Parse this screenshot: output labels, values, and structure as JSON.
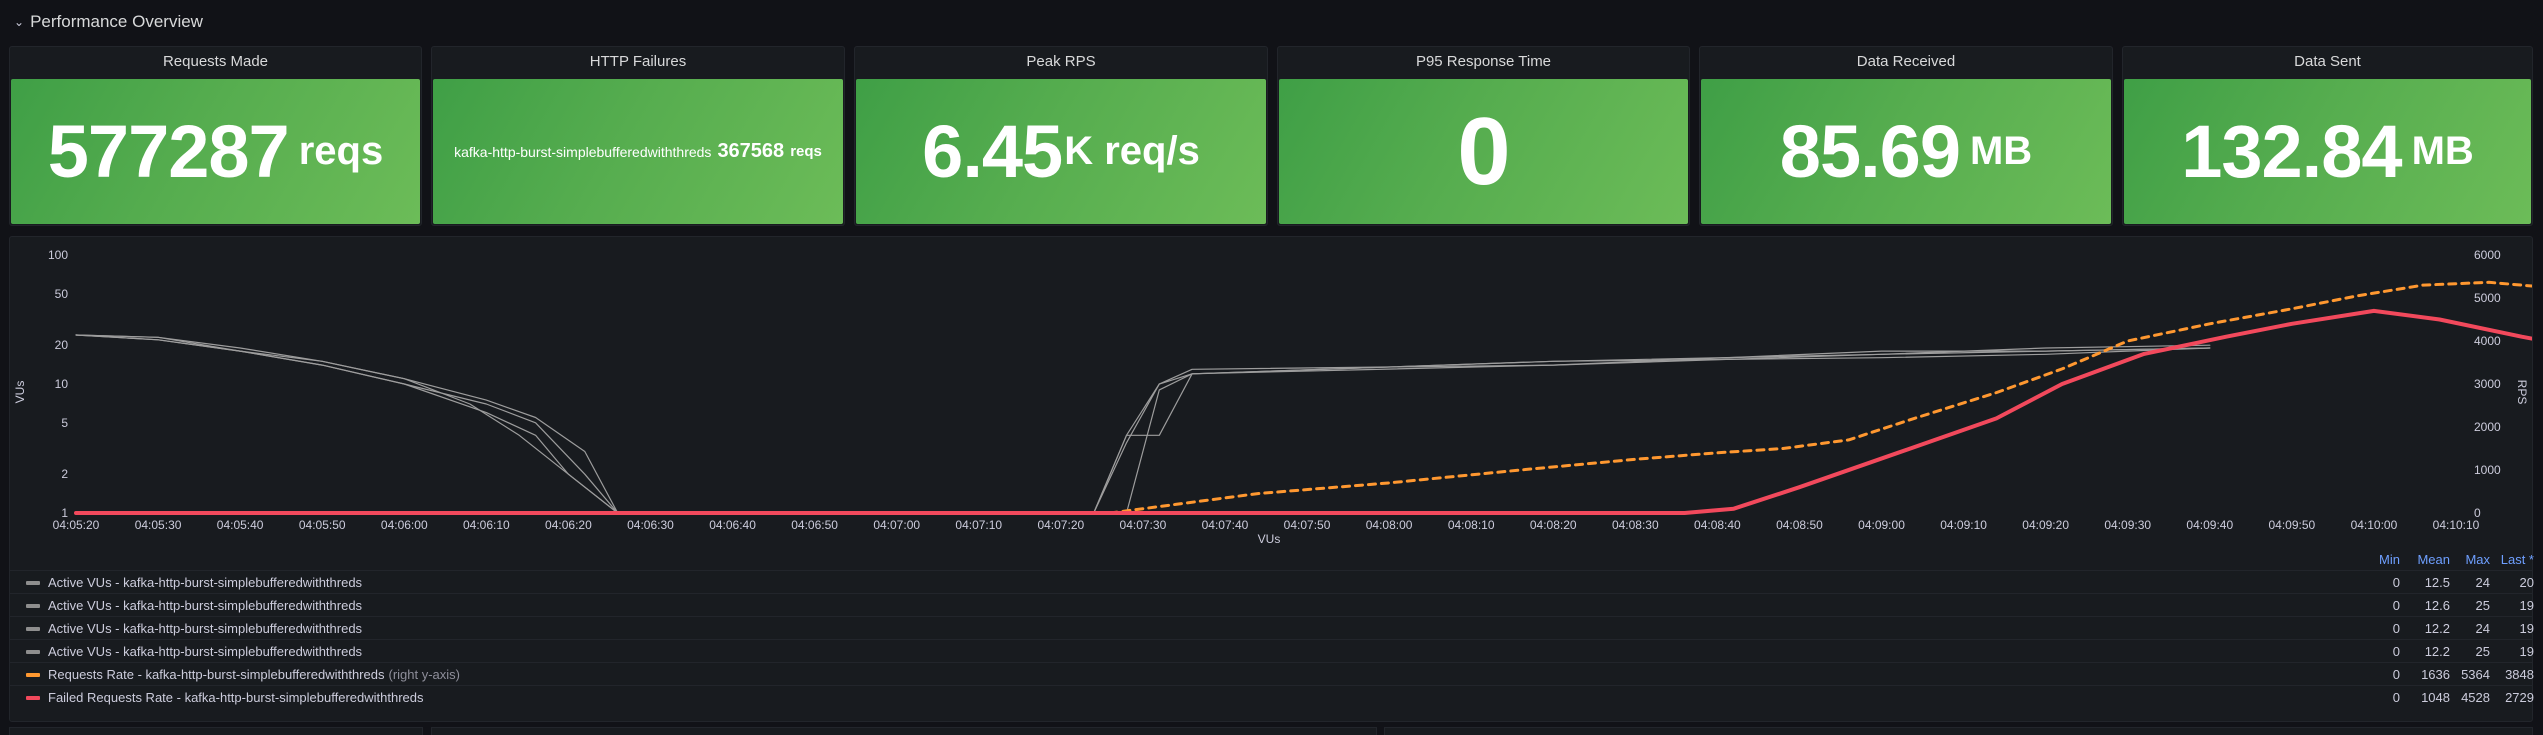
{
  "row": {
    "title": "Performance Overview"
  },
  "stats": [
    {
      "title": "Requests Made",
      "value": "577287",
      "unit": "reqs"
    },
    {
      "title": "HTTP Failures",
      "label": "kafka-http-burst-simplebufferedwiththreds",
      "value": "367568",
      "unit": "reqs"
    },
    {
      "title": "Peak RPS",
      "value": "6.45",
      "unit": "K req/s"
    },
    {
      "title": "P95 Response Time",
      "value": "0"
    },
    {
      "title": "Data Received",
      "value": "85.69",
      "unit": "MB"
    },
    {
      "title": "Data Sent",
      "value": "132.84",
      "unit": "MB"
    }
  ],
  "colors": {
    "stat_green": "#56ad4f",
    "vus": "#9d9d9d",
    "requests": "#ff9830",
    "failed": "#f2495c",
    "legend_header": "#6e9fff"
  },
  "graph": {
    "left_axis_label": "VUs",
    "right_axis_label": "RPS",
    "x_axis_label": "VUs",
    "legend_headers": {
      "min": "Min",
      "mean": "Mean",
      "max": "Max",
      "last": "Last *"
    },
    "legend": [
      {
        "name": "Active VUs - kafka-http-burst-simplebufferedwiththreds",
        "note": "",
        "color": "#8e8e8e",
        "min": "0",
        "mean": "12.5",
        "max": "24",
        "last": "20"
      },
      {
        "name": "Active VUs - kafka-http-burst-simplebufferedwiththreds",
        "note": "",
        "color": "#8e8e8e",
        "min": "0",
        "mean": "12.6",
        "max": "25",
        "last": "19"
      },
      {
        "name": "Active VUs - kafka-http-burst-simplebufferedwiththreds",
        "note": "",
        "color": "#8e8e8e",
        "min": "0",
        "mean": "12.2",
        "max": "24",
        "last": "19"
      },
      {
        "name": "Active VUs - kafka-http-burst-simplebufferedwiththreds",
        "note": "",
        "color": "#8e8e8e",
        "min": "0",
        "mean": "12.2",
        "max": "25",
        "last": "19"
      },
      {
        "name": "Requests Rate - kafka-http-burst-simplebufferedwiththreds",
        "note": "(right y-axis)",
        "color": "#ff9830",
        "min": "0",
        "mean": "1636",
        "max": "5364",
        "last": "3848"
      },
      {
        "name": "Failed Requests Rate - kafka-http-burst-simplebufferedwiththreds",
        "note": "",
        "color": "#f2495c",
        "min": "0",
        "mean": "1048",
        "max": "4528",
        "last": "2729"
      }
    ]
  },
  "chart_data": {
    "type": "line",
    "xlabel": "VUs",
    "ylabel": "VUs",
    "y2label": "RPS",
    "yscale": "log",
    "ylim": [
      1,
      100
    ],
    "y2lim": [
      0,
      6000
    ],
    "yticks": [
      "1",
      "2",
      "5",
      "10",
      "20",
      "50",
      "100"
    ],
    "y2ticks": [
      "0",
      "1000",
      "2000",
      "3000",
      "4000",
      "5000",
      "6000"
    ],
    "xticks": [
      "04:05:20",
      "04:05:30",
      "04:05:40",
      "04:05:50",
      "04:06:00",
      "04:06:10",
      "04:06:20",
      "04:06:30",
      "04:06:40",
      "04:06:50",
      "04:07:00",
      "04:07:10",
      "04:07:20",
      "04:07:30",
      "04:07:40",
      "04:07:50",
      "04:08:00",
      "04:08:10",
      "04:08:20",
      "04:08:30",
      "04:08:40",
      "04:08:50",
      "04:09:00",
      "04:09:10",
      "04:09:20",
      "04:09:30",
      "04:09:40",
      "04:09:50",
      "04:10:00",
      "04:10:10"
    ],
    "series": [
      {
        "name": "Active VUs - kafka-http-burst-simplebufferedwiththreds",
        "axis": "left",
        "points": [
          [
            0,
            24
          ],
          [
            5,
            23
          ],
          [
            10,
            19
          ],
          [
            15,
            15
          ],
          [
            20,
            11
          ],
          [
            25,
            7.5
          ],
          [
            28,
            5.5
          ],
          [
            31,
            3
          ],
          [
            33,
            1
          ],
          [
            62,
            1
          ],
          [
            64,
            4
          ],
          [
            66,
            4
          ],
          [
            68,
            12
          ],
          [
            90,
            15
          ],
          [
            110,
            17
          ],
          [
            120,
            19
          ],
          [
            130,
            20
          ]
        ]
      },
      {
        "name": "Active VUs - kafka-http-burst-simplebufferedwiththreds",
        "axis": "left",
        "points": [
          [
            0,
            24
          ],
          [
            5,
            22
          ],
          [
            10,
            18
          ],
          [
            15,
            14
          ],
          [
            20,
            10
          ],
          [
            25,
            7
          ],
          [
            28,
            5
          ],
          [
            31,
            2
          ],
          [
            33,
            1
          ],
          [
            62,
            1
          ],
          [
            64,
            3.5
          ],
          [
            66,
            10
          ],
          [
            68,
            13
          ],
          [
            90,
            14
          ],
          [
            110,
            18
          ],
          [
            120,
            18
          ],
          [
            130,
            19
          ]
        ]
      },
      {
        "name": "Active VUs - kafka-http-burst-simplebufferedwiththreds",
        "axis": "left",
        "points": [
          [
            0,
            24
          ],
          [
            5,
            23
          ],
          [
            10,
            18
          ],
          [
            15,
            15
          ],
          [
            20,
            11
          ],
          [
            24,
            7
          ],
          [
            27,
            4
          ],
          [
            30,
            2
          ],
          [
            33,
            1
          ],
          [
            62,
            1
          ],
          [
            64,
            4
          ],
          [
            66,
            10
          ],
          [
            68,
            12
          ],
          [
            90,
            15
          ],
          [
            110,
            16
          ],
          [
            120,
            17
          ],
          [
            130,
            19
          ]
        ]
      },
      {
        "name": "Active VUs - kafka-http-burst-simplebufferedwiththreds",
        "axis": "left",
        "points": [
          [
            0,
            24
          ],
          [
            5,
            22
          ],
          [
            10,
            18
          ],
          [
            15,
            14
          ],
          [
            20,
            10
          ],
          [
            25,
            6
          ],
          [
            28,
            4
          ],
          [
            30,
            2
          ],
          [
            33,
            1
          ],
          [
            62,
            1
          ],
          [
            64,
            1
          ],
          [
            66,
            9
          ],
          [
            68,
            12
          ],
          [
            90,
            14
          ],
          [
            110,
            17
          ],
          [
            120,
            18
          ],
          [
            130,
            19
          ]
        ]
      },
      {
        "name": "Requests Rate - kafka-http-burst-simplebufferedwiththreds",
        "axis": "right",
        "dashed": true,
        "points": [
          [
            63,
            0
          ],
          [
            67,
            200
          ],
          [
            72,
            450
          ],
          [
            80,
            700
          ],
          [
            88,
            1000
          ],
          [
            95,
            1250
          ],
          [
            100,
            1400
          ],
          [
            104,
            1500
          ],
          [
            108,
            1700
          ],
          [
            112,
            2200
          ],
          [
            117,
            2800
          ],
          [
            121,
            3350
          ],
          [
            125,
            4000
          ],
          [
            130,
            4400
          ],
          [
            135,
            4750
          ],
          [
            139,
            5050
          ],
          [
            143,
            5300
          ],
          [
            147,
            5364
          ],
          [
            152,
            5200
          ],
          [
            157,
            4900
          ],
          [
            161,
            4600
          ],
          [
            165,
            4300
          ],
          [
            169,
            4000
          ],
          [
            173,
            3848
          ]
        ]
      },
      {
        "name": "Failed Requests Rate - kafka-http-burst-simplebufferedwiththreds",
        "axis": "right",
        "points": [
          [
            0,
            0
          ],
          [
            52,
            0
          ],
          [
            55,
            0
          ],
          [
            98,
            0
          ],
          [
            101,
            100
          ],
          [
            105,
            600
          ],
          [
            111,
            1400
          ],
          [
            117,
            2200
          ],
          [
            121,
            3000
          ],
          [
            126,
            3700
          ],
          [
            131,
            4100
          ],
          [
            135,
            4400
          ],
          [
            140,
            4700
          ],
          [
            144,
            4500
          ],
          [
            149,
            4100
          ],
          [
            154,
            3750
          ],
          [
            159,
            3300
          ],
          [
            165,
            3000
          ],
          [
            168,
            2900
          ],
          [
            171,
            2729
          ]
        ]
      }
    ]
  }
}
